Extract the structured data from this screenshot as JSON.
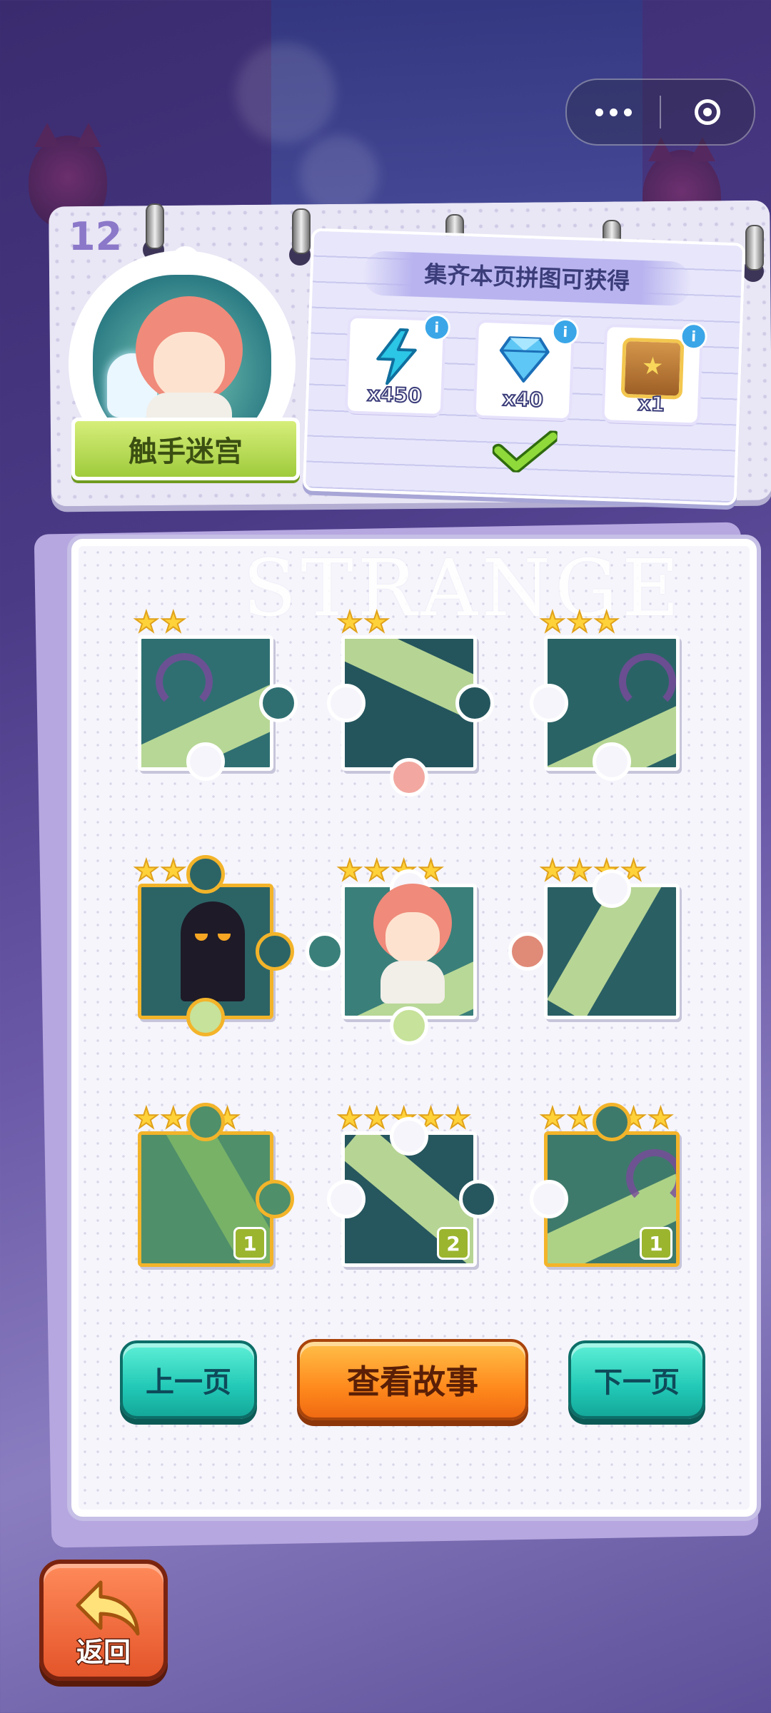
{
  "capsule": {
    "more_icon": "more-dots-icon",
    "close_icon": "target-icon"
  },
  "chapter": {
    "number": "12",
    "title": "触手迷宫"
  },
  "reward": {
    "title": "集齐本页拼图可获得",
    "items": [
      {
        "icon": "energy-bolt-icon",
        "qty": "x450"
      },
      {
        "icon": "diamond-icon",
        "qty": "x40"
      },
      {
        "icon": "treasure-chest-icon",
        "qty": "x1"
      }
    ],
    "claimed_icon": "checkmark-icon"
  },
  "watermark": "STRANGE",
  "pieces": [
    {
      "stars": 2,
      "frame": "white",
      "count": null
    },
    {
      "stars": 2,
      "frame": "white",
      "count": null
    },
    {
      "stars": 3,
      "frame": "white",
      "count": null
    },
    {
      "stars": 3,
      "frame": "gold",
      "count": null
    },
    {
      "stars": 4,
      "frame": "white",
      "count": null
    },
    {
      "stars": 4,
      "frame": "white",
      "count": null
    },
    {
      "stars": 4,
      "frame": "gold",
      "count": "1"
    },
    {
      "stars": 5,
      "frame": "white",
      "count": "2"
    },
    {
      "stars": 5,
      "frame": "gold",
      "count": "1"
    }
  ],
  "buttons": {
    "prev": "上一页",
    "story": "查看故事",
    "next": "下一页"
  },
  "back": {
    "label": "返回",
    "icon": "back-arrow-icon"
  },
  "colors": {
    "teal": "#22c9b6",
    "orange": "#ff8a1d",
    "gold": "#f3b42a",
    "star": "#ffd23a"
  }
}
